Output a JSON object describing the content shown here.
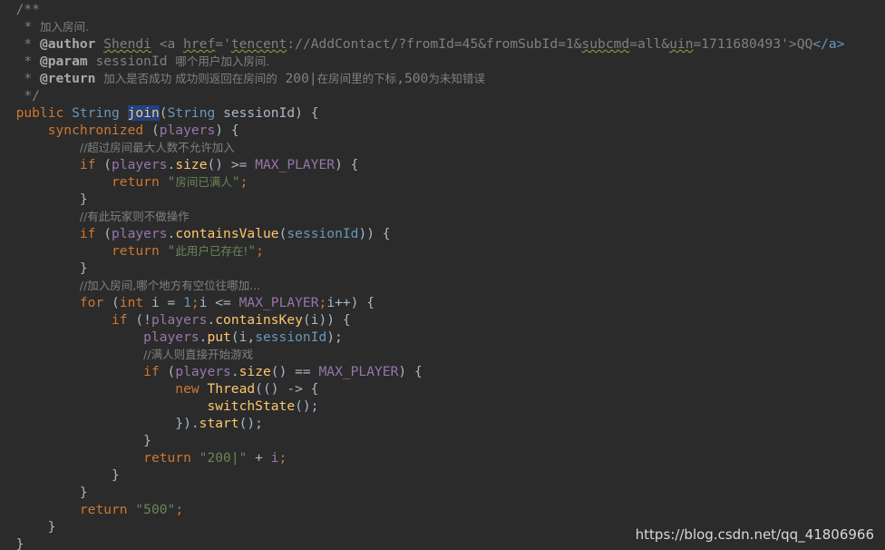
{
  "editor": {
    "lines": [
      {
        "segments": [
          {
            "text": "  /**",
            "cls": "cm"
          }
        ]
      },
      {
        "segments": [
          {
            "text": "   * ",
            "cls": "cm"
          },
          {
            "text": "加入房间.",
            "cls": "cmt"
          }
        ]
      },
      {
        "segments": [
          {
            "text": "   * ",
            "cls": "cm"
          },
          {
            "text": "@author",
            "cls": "tag"
          },
          {
            "text": " ",
            "cls": "cm"
          },
          {
            "text": "Shendi",
            "cls": "cm ul"
          },
          {
            "text": " <a ",
            "cls": "cm"
          },
          {
            "text": "href",
            "cls": "cm ul"
          },
          {
            "text": "='",
            "cls": "cm"
          },
          {
            "text": "tencent",
            "cls": "cm ul"
          },
          {
            "text": "://AddContact/?fromId=45&fromSubId=1&",
            "cls": "cm"
          },
          {
            "text": "subcmd",
            "cls": "cm ul"
          },
          {
            "text": "=all&",
            "cls": "cm"
          },
          {
            "text": "uin",
            "cls": "cm ul"
          },
          {
            "text": "=1711680493'>QQ",
            "cls": "cm"
          },
          {
            "text": "</a>",
            "cls": "tp"
          }
        ]
      },
      {
        "segments": [
          {
            "text": "   * ",
            "cls": "cm"
          },
          {
            "text": "@param",
            "cls": "tag"
          },
          {
            "text": " sessionId ",
            "cls": "cm"
          },
          {
            "text": "哪个用户加入房间.",
            "cls": "cmt"
          }
        ]
      },
      {
        "segments": [
          {
            "text": "   * ",
            "cls": "cm"
          },
          {
            "text": "@return",
            "cls": "tag"
          },
          {
            "text": " ",
            "cls": "cm"
          },
          {
            "text": "加入是否成功 成功则返回在房间的",
            "cls": "cmt"
          },
          {
            "text": " 200|",
            "cls": "cm"
          },
          {
            "text": "在房间里的下标",
            "cls": "cmt"
          },
          {
            "text": ",500",
            "cls": "cm"
          },
          {
            "text": "为未知错误",
            "cls": "cmt"
          }
        ]
      },
      {
        "segments": [
          {
            "text": "   */",
            "cls": "cm"
          }
        ]
      },
      {
        "segments": [
          {
            "text": "  ",
            "cls": ""
          },
          {
            "text": "public",
            "cls": "kw"
          },
          {
            "text": " ",
            "cls": ""
          },
          {
            "text": "String",
            "cls": "tp"
          },
          {
            "text": " ",
            "cls": ""
          },
          {
            "text": "join",
            "cls": "fn hl"
          },
          {
            "text": "(",
            "cls": ""
          },
          {
            "text": "String",
            "cls": "tp"
          },
          {
            "text": " sessionId) {",
            "cls": ""
          }
        ]
      },
      {
        "segments": [
          {
            "text": "      ",
            "cls": ""
          },
          {
            "text": "synchronized",
            "cls": "kw"
          },
          {
            "text": " (",
            "cls": ""
          },
          {
            "text": "players",
            "cls": "fld"
          },
          {
            "text": ") {",
            "cls": ""
          }
        ]
      },
      {
        "segments": [
          {
            "text": "          ",
            "cls": ""
          },
          {
            "text": "//超过房间最大人数不允许加入",
            "cls": "cmt"
          }
        ]
      },
      {
        "segments": [
          {
            "text": "          ",
            "cls": ""
          },
          {
            "text": "if",
            "cls": "kw"
          },
          {
            "text": " (",
            "cls": ""
          },
          {
            "text": "players",
            "cls": "fld"
          },
          {
            "text": ".",
            "cls": ""
          },
          {
            "text": "size",
            "cls": "fn"
          },
          {
            "text": "() >= ",
            "cls": ""
          },
          {
            "text": "MAX_PLAYER",
            "cls": "fld"
          },
          {
            "text": ") {",
            "cls": ""
          }
        ]
      },
      {
        "segments": [
          {
            "text": "              ",
            "cls": ""
          },
          {
            "text": "return",
            "cls": "kw"
          },
          {
            "text": " \"",
            "cls": "str"
          },
          {
            "text": "房间已满人",
            "cls": "str cjk"
          },
          {
            "text": "\"",
            "cls": "str"
          },
          {
            "text": ";",
            "cls": "kw"
          }
        ]
      },
      {
        "segments": [
          {
            "text": "          }",
            "cls": ""
          }
        ]
      },
      {
        "segments": [
          {
            "text": "          ",
            "cls": ""
          },
          {
            "text": "//有此玩家则不做操作",
            "cls": "cmt"
          }
        ]
      },
      {
        "segments": [
          {
            "text": "          ",
            "cls": ""
          },
          {
            "text": "if",
            "cls": "kw"
          },
          {
            "text": " (",
            "cls": ""
          },
          {
            "text": "players",
            "cls": "fld"
          },
          {
            "text": ".",
            "cls": ""
          },
          {
            "text": "containsValue",
            "cls": "fn"
          },
          {
            "text": "(",
            "cls": ""
          },
          {
            "text": "sessionId",
            "cls": "tp"
          },
          {
            "text": ")) {",
            "cls": ""
          }
        ]
      },
      {
        "segments": [
          {
            "text": "              ",
            "cls": ""
          },
          {
            "text": "return",
            "cls": "kw"
          },
          {
            "text": " \"",
            "cls": "str"
          },
          {
            "text": "此用户已存在!",
            "cls": "str cjk"
          },
          {
            "text": "\"",
            "cls": "str"
          },
          {
            "text": ";",
            "cls": "kw"
          }
        ]
      },
      {
        "segments": [
          {
            "text": "          }",
            "cls": ""
          }
        ]
      },
      {
        "segments": [
          {
            "text": "          ",
            "cls": ""
          },
          {
            "text": "//加入房间,哪个地方有空位往哪加...",
            "cls": "cmt"
          }
        ]
      },
      {
        "segments": [
          {
            "text": "          ",
            "cls": ""
          },
          {
            "text": "for",
            "cls": "kw"
          },
          {
            "text": " (",
            "cls": ""
          },
          {
            "text": "int",
            "cls": "kw"
          },
          {
            "text": " i = ",
            "cls": ""
          },
          {
            "text": "1",
            "cls": "num"
          },
          {
            "text": ";",
            "cls": "kw"
          },
          {
            "text": "i <= ",
            "cls": ""
          },
          {
            "text": "MAX_PLAYER",
            "cls": "fld"
          },
          {
            "text": ";",
            "cls": "kw"
          },
          {
            "text": "i++) {",
            "cls": ""
          }
        ]
      },
      {
        "segments": [
          {
            "text": "              ",
            "cls": ""
          },
          {
            "text": "if",
            "cls": "kw"
          },
          {
            "text": " (!",
            "cls": ""
          },
          {
            "text": "players",
            "cls": "fld"
          },
          {
            "text": ".",
            "cls": ""
          },
          {
            "text": "containsKey",
            "cls": "fn"
          },
          {
            "text": "(i)) {",
            "cls": ""
          }
        ]
      },
      {
        "segments": [
          {
            "text": "                  ",
            "cls": ""
          },
          {
            "text": "players",
            "cls": "fld"
          },
          {
            "text": ".",
            "cls": ""
          },
          {
            "text": "put",
            "cls": "fn"
          },
          {
            "text": "(i,",
            "cls": ""
          },
          {
            "text": "sessionId",
            "cls": "tp"
          },
          {
            "text": ");",
            "cls": ""
          }
        ]
      },
      {
        "segments": [
          {
            "text": "                  ",
            "cls": ""
          },
          {
            "text": "//满人则直接开始游戏",
            "cls": "cmt"
          }
        ]
      },
      {
        "segments": [
          {
            "text": "                  ",
            "cls": ""
          },
          {
            "text": "if",
            "cls": "kw"
          },
          {
            "text": " (",
            "cls": ""
          },
          {
            "text": "players",
            "cls": "fld"
          },
          {
            "text": ".",
            "cls": ""
          },
          {
            "text": "size",
            "cls": "fn"
          },
          {
            "text": "() == ",
            "cls": ""
          },
          {
            "text": "MAX_PLAYER",
            "cls": "fld"
          },
          {
            "text": ") {",
            "cls": ""
          }
        ]
      },
      {
        "segments": [
          {
            "text": "                      ",
            "cls": ""
          },
          {
            "text": "new",
            "cls": "kw"
          },
          {
            "text": " ",
            "cls": ""
          },
          {
            "text": "Thread",
            "cls": "fn"
          },
          {
            "text": "(() -> {",
            "cls": ""
          }
        ]
      },
      {
        "segments": [
          {
            "text": "                          ",
            "cls": ""
          },
          {
            "text": "switchState",
            "cls": "fn"
          },
          {
            "text": "();",
            "cls": ""
          }
        ]
      },
      {
        "segments": [
          {
            "text": "                      }).",
            "cls": ""
          },
          {
            "text": "start",
            "cls": "fn"
          },
          {
            "text": "();",
            "cls": ""
          }
        ]
      },
      {
        "segments": [
          {
            "text": "                  }",
            "cls": ""
          }
        ]
      },
      {
        "segments": [
          {
            "text": "                  ",
            "cls": ""
          },
          {
            "text": "return",
            "cls": "kw"
          },
          {
            "text": " ",
            "cls": ""
          },
          {
            "text": "\"200|\"",
            "cls": "str"
          },
          {
            "text": " + ",
            "cls": ""
          },
          {
            "text": "i",
            "cls": "fld"
          },
          {
            "text": ";",
            "cls": "kw"
          }
        ]
      },
      {
        "segments": [
          {
            "text": "              }",
            "cls": ""
          }
        ]
      },
      {
        "segments": [
          {
            "text": "          }",
            "cls": ""
          }
        ]
      },
      {
        "segments": [
          {
            "text": "          ",
            "cls": ""
          },
          {
            "text": "return",
            "cls": "kw"
          },
          {
            "text": " ",
            "cls": ""
          },
          {
            "text": "\"500\"",
            "cls": "str"
          },
          {
            "text": ";",
            "cls": "kw"
          }
        ]
      },
      {
        "segments": [
          {
            "text": "      }",
            "cls": ""
          }
        ]
      },
      {
        "segments": [
          {
            "text": "  }",
            "cls": ""
          }
        ]
      }
    ]
  },
  "watermark": "https://blog.csdn.net/qq_41806966",
  "colors": {
    "background": "#2b2b2b",
    "keyword": "#cc7832",
    "type": "#6897bb",
    "comment": "#808080",
    "string": "#6a8759",
    "field": "#9876aa",
    "method": "#ffc66d",
    "selection": "#214283"
  }
}
